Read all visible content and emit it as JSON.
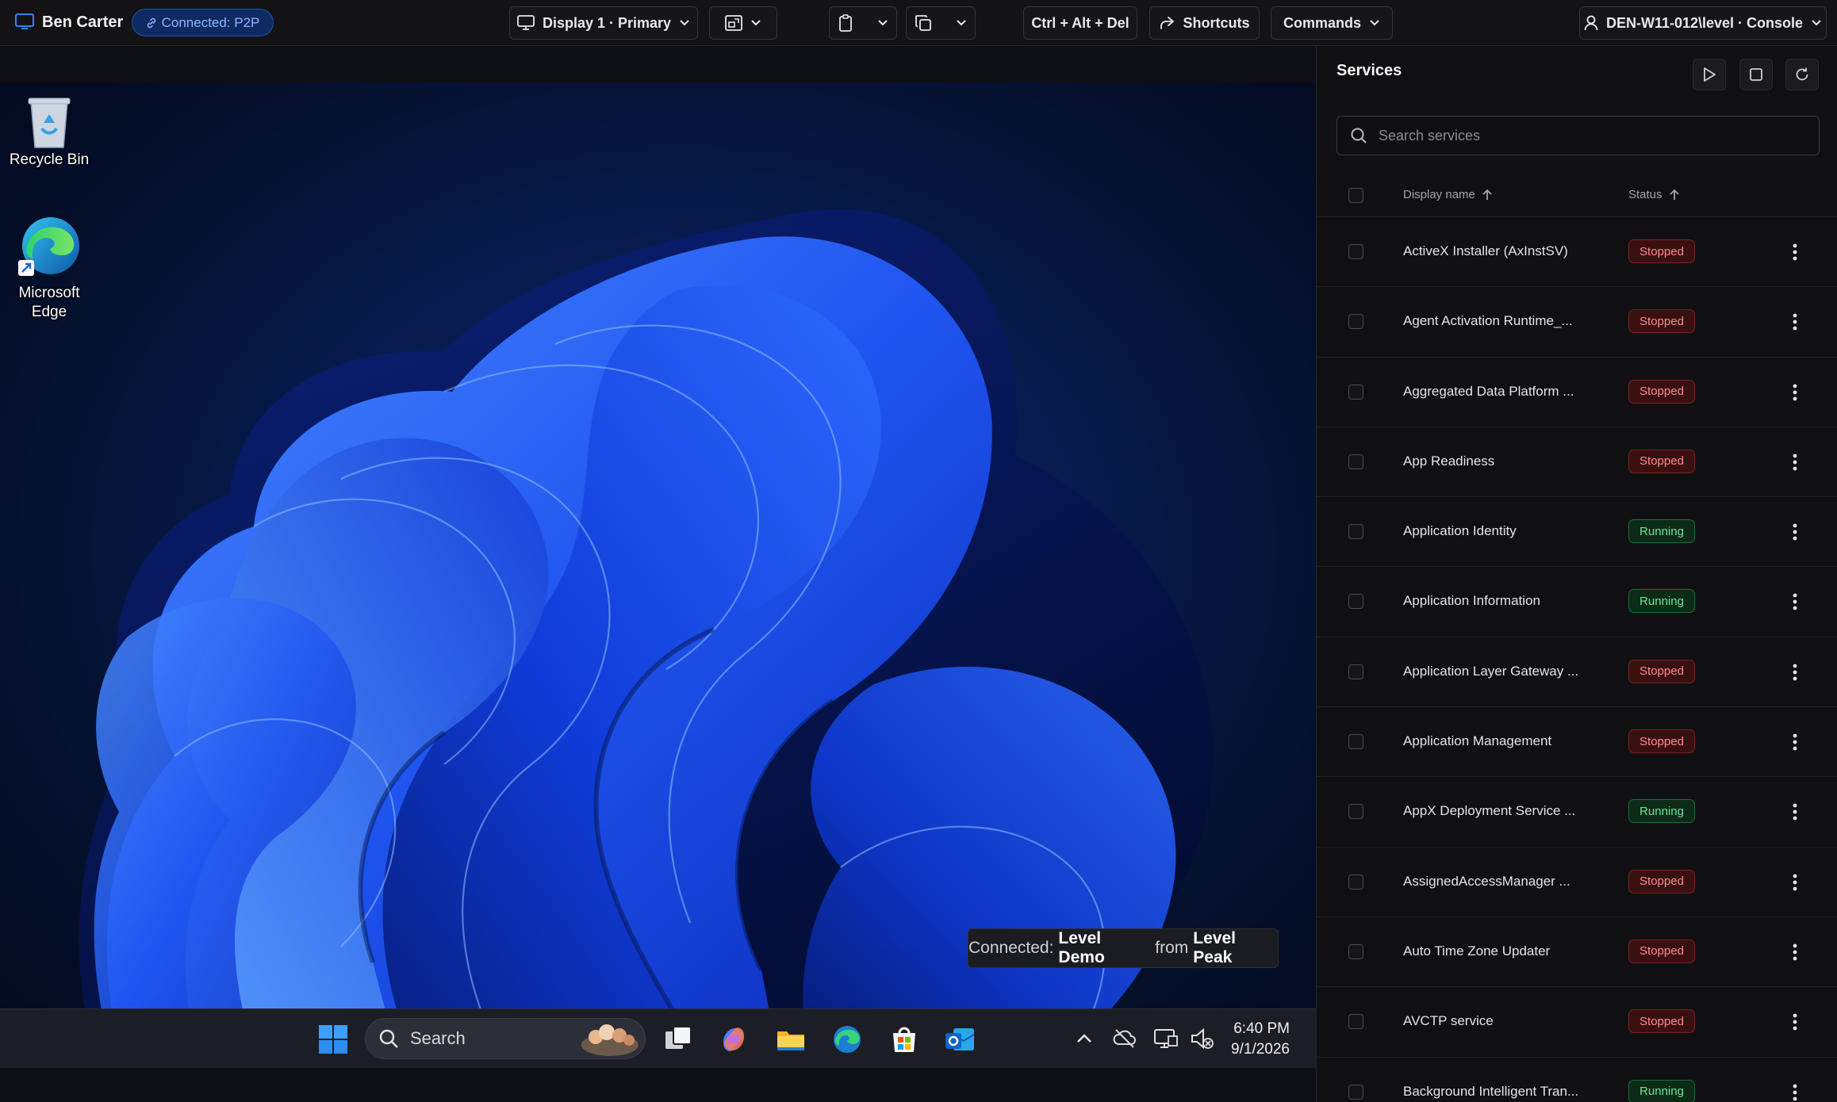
{
  "toolbar": {
    "user_name": "Ben Carter",
    "connection_badge": "Connected: P2P",
    "display_select": "Display 1 · Primary",
    "ctrl_alt_del": "Ctrl + Alt + Del",
    "shortcuts": "Shortcuts",
    "commands": "Commands",
    "session": "DEN-W11-012\\level · Console"
  },
  "desktop": {
    "icons": [
      {
        "label": "Recycle Bin"
      },
      {
        "label": "Microsoft Edge"
      }
    ],
    "taskbar": {
      "search_label": "Search",
      "time": "6:40 PM",
      "date": "9/1/2026"
    },
    "toast": {
      "prefix": "Connected:",
      "org": "Level Demo",
      "mid": "from",
      "source": "Level Peak"
    }
  },
  "services": {
    "title": "Services",
    "search_placeholder": "Search services",
    "col_name": "Display name",
    "col_status": "Status",
    "rows": [
      {
        "name": "ActiveX Installer (AxInstSV)",
        "status": "Stopped"
      },
      {
        "name": "Agent Activation Runtime_...",
        "status": "Stopped"
      },
      {
        "name": "Aggregated Data Platform ...",
        "status": "Stopped"
      },
      {
        "name": "App Readiness",
        "status": "Stopped"
      },
      {
        "name": "Application Identity",
        "status": "Running"
      },
      {
        "name": "Application Information",
        "status": "Running"
      },
      {
        "name": "Application Layer Gateway ...",
        "status": "Stopped"
      },
      {
        "name": "Application Management",
        "status": "Stopped"
      },
      {
        "name": "AppX Deployment Service ...",
        "status": "Running"
      },
      {
        "name": "AssignedAccessManager ...",
        "status": "Stopped"
      },
      {
        "name": "Auto Time Zone Updater",
        "status": "Stopped"
      },
      {
        "name": "AVCTP service",
        "status": "Stopped"
      },
      {
        "name": "Background Intelligent Tran...",
        "status": "Running"
      }
    ]
  },
  "colors": {
    "accent": "#1f4fae",
    "stopped": "#ff8c8c",
    "running": "#6fe39a"
  }
}
